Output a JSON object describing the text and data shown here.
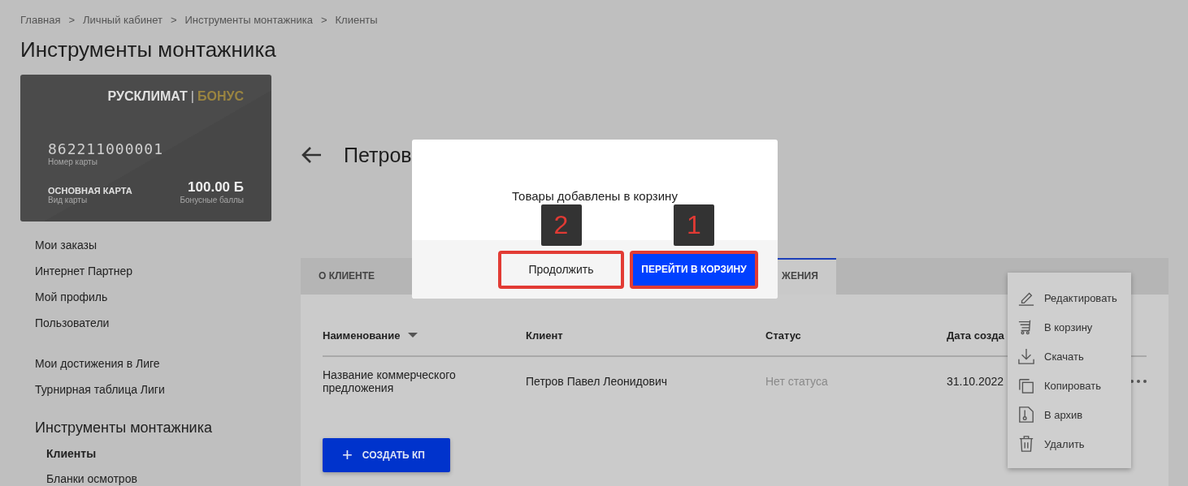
{
  "breadcrumbs": [
    {
      "label": "Главная",
      "separator": ">"
    },
    {
      "label": "Личный кабинет",
      "separator": ">"
    },
    {
      "label": "Инструменты монтажника",
      "separator": ">"
    },
    {
      "label": "Клиенты"
    }
  ],
  "page_title": "Инструменты монтажника",
  "card": {
    "brand": "РУСКЛИМАТ",
    "divider": "|",
    "program": "БОНУС",
    "number": "862211000001",
    "number_caption": "Номер карты",
    "type": "ОСНОВНАЯ КАРТА",
    "type_caption": "Вид карты",
    "points": "100.00 Б",
    "points_caption": "Бонусные баллы"
  },
  "sidebar": {
    "groups": [
      {
        "items": [
          {
            "label": "Мои заказы",
            "selected": false
          },
          {
            "label": "Интернет Партнер",
            "selected": false
          },
          {
            "label": "Мой профиль",
            "selected": false
          },
          {
            "label": "Пользователи",
            "selected": false
          }
        ]
      },
      {
        "items": [
          {
            "label": "Мои достижения в Лиге",
            "selected": false
          },
          {
            "label": "Турнирная таблица Лиги",
            "selected": false
          }
        ]
      },
      {
        "title": "Инструменты монтажника",
        "items": [
          {
            "label": "Клиенты",
            "selected": true
          },
          {
            "label": "Бланки осмотров",
            "selected": false
          }
        ]
      }
    ]
  },
  "client_heading": "Петров",
  "tabs": [
    {
      "label": "О КЛИЕНТЕ",
      "selected": false
    },
    {
      "label": "ЖЕНИЯ",
      "selected": true
    }
  ],
  "table": {
    "columns": [
      {
        "label": "Наименование",
        "sorted": true
      },
      {
        "label": "Клиент",
        "sorted": false
      },
      {
        "label": "Статус",
        "sorted": false
      },
      {
        "label": "Дата созда",
        "sorted": false
      }
    ],
    "rows": [
      {
        "name": "Название коммерческого предложения",
        "client": "Петров Павел Леонидович",
        "status": "Нет статуса",
        "date": "31.10.2022"
      }
    ]
  },
  "create_button": {
    "icon": "+",
    "label": "СОЗДАТЬ КП"
  },
  "context_menu": [
    {
      "label": "Редактировать"
    },
    {
      "label": "В корзину"
    },
    {
      "label": "Скачать"
    },
    {
      "label": "Копировать"
    },
    {
      "label": "В архив"
    },
    {
      "label": "Удалить"
    }
  ],
  "modal": {
    "message": "Товары добавлены в корзину",
    "buttons": [
      {
        "label": "Продолжить",
        "kind": "secondary",
        "annotation": "2"
      },
      {
        "label": "ПЕРЕЙТИ В КОРЗИНУ",
        "kind": "primary",
        "annotation": "1"
      }
    ]
  }
}
